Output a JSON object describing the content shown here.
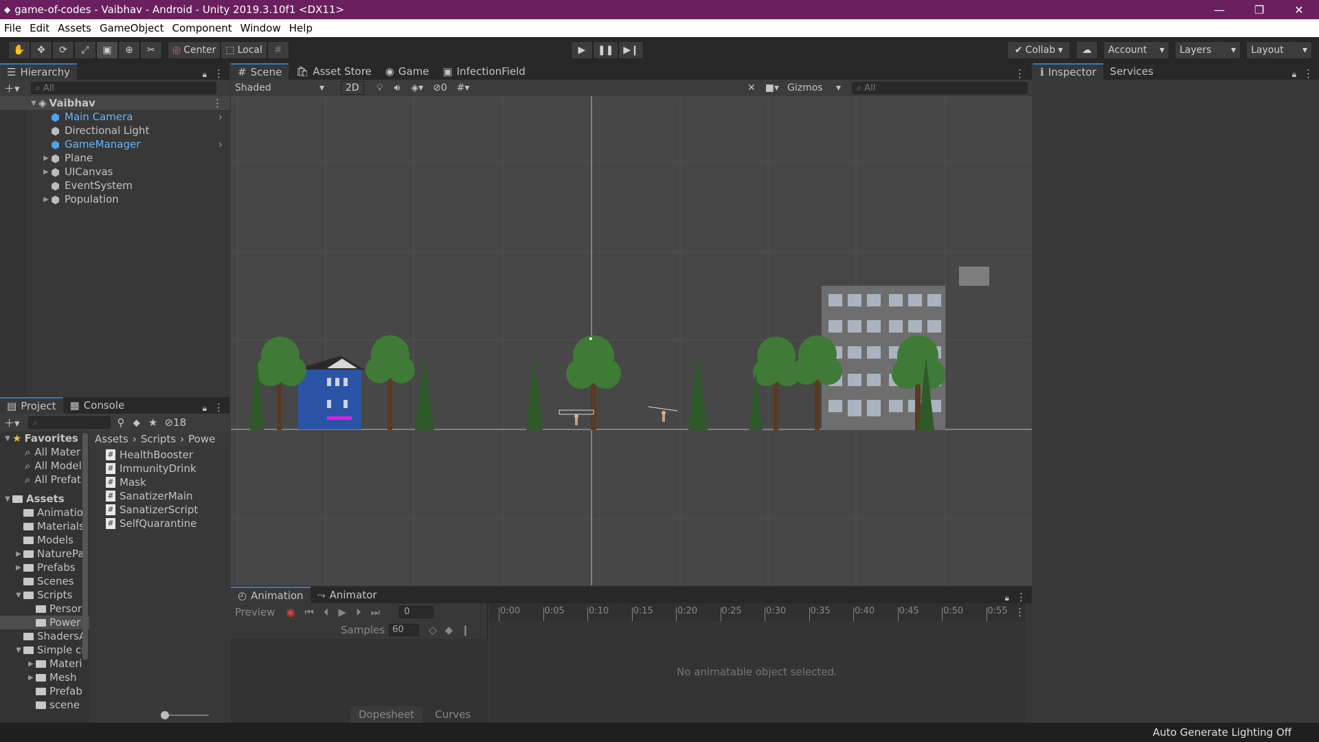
{
  "window": {
    "title": "game-of-codes - Vaibhav - Android - Unity 2019.3.10f1 <DX11>"
  },
  "menu": [
    "File",
    "Edit",
    "Assets",
    "GameObject",
    "Component",
    "Window",
    "Help"
  ],
  "toolbar": {
    "pivot_center": "Center",
    "pivot_local": "Local",
    "collab": "Collab",
    "account": "Account",
    "layers": "Layers",
    "layout": "Layout"
  },
  "hierarchy": {
    "tab": "Hierarchy",
    "search_placeholder": "All",
    "scene": "Vaibhav",
    "items": [
      {
        "label": "Main Camera",
        "selected": true
      },
      {
        "label": "Directional Light"
      },
      {
        "label": "GameManager",
        "selected": true
      },
      {
        "label": "Plane",
        "expandable": true
      },
      {
        "label": "UICanvas",
        "expandable": true
      },
      {
        "label": "EventSystem"
      },
      {
        "label": "Population",
        "expandable": true
      }
    ]
  },
  "scene_view": {
    "tabs": [
      "Scene",
      "Asset Store",
      "Game",
      "InfectionField"
    ],
    "shading": "Shaded",
    "mode_2d": "2D",
    "hidden_count": "0",
    "gizmos": "Gizmos",
    "search_placeholder": "All"
  },
  "inspector": {
    "tabs": [
      "Inspector",
      "Services"
    ]
  },
  "project": {
    "tabs": [
      "Project",
      "Console"
    ],
    "hidden_count": "18",
    "favorites_label": "Favorites",
    "favorites": [
      "All Mater",
      "All Model",
      "All Prefat"
    ],
    "assets_label": "Assets",
    "folders": [
      {
        "label": "Animatioi",
        "indent": 1
      },
      {
        "label": "Materials",
        "indent": 1
      },
      {
        "label": "Models",
        "indent": 1
      },
      {
        "label": "NaturePa",
        "indent": 1,
        "arrow": "▶"
      },
      {
        "label": "Prefabs",
        "indent": 1,
        "arrow": "▶"
      },
      {
        "label": "Scenes",
        "indent": 1
      },
      {
        "label": "Scripts",
        "indent": 1,
        "arrow": "▼"
      },
      {
        "label": "Persor",
        "indent": 2
      },
      {
        "label": "Power",
        "indent": 2,
        "selected": true
      },
      {
        "label": "ShadersA",
        "indent": 1
      },
      {
        "label": "Simple ci",
        "indent": 1,
        "arrow": "▼"
      },
      {
        "label": "Materi",
        "indent": 2,
        "arrow": "▶"
      },
      {
        "label": "Mesh",
        "indent": 2,
        "arrow": "▶"
      },
      {
        "label": "Prefab",
        "indent": 2
      },
      {
        "label": "scene",
        "indent": 2
      }
    ],
    "breadcrumb": [
      "Assets",
      "Scripts",
      "Powe"
    ],
    "files": [
      "HealthBooster",
      "ImmunityDrink",
      "Mask",
      "SanatizerMain",
      "SanatizerScript",
      "SelfQuarantine"
    ]
  },
  "animation": {
    "tabs": [
      "Animation",
      "Animator"
    ],
    "preview": "Preview",
    "frame": "0",
    "samples_label": "Samples",
    "samples": "60",
    "time_marks": [
      "0:00",
      "0:05",
      "0:10",
      "0:15",
      "0:20",
      "0:25",
      "0:30",
      "0:35",
      "0:40",
      "0:45",
      "0:50",
      "0:55"
    ],
    "empty_msg": "No animatable object selected.",
    "dopesheet": "Dopesheet",
    "curves": "Curves"
  },
  "status": {
    "lighting": "Auto Generate Lighting Off"
  }
}
